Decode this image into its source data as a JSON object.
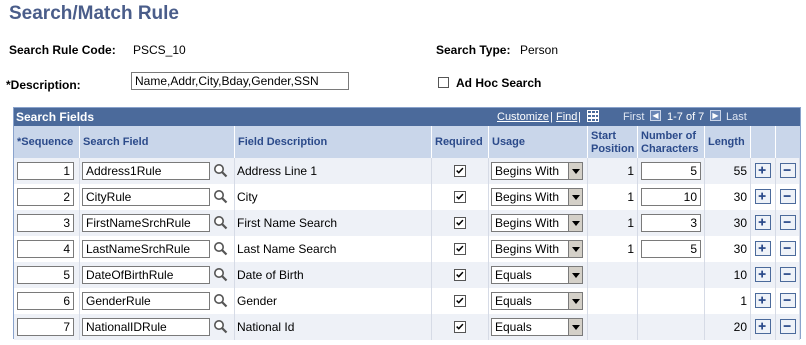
{
  "page": {
    "title": "Search/Match Rule",
    "search_rule_code_label": "Search Rule Code:",
    "search_rule_code_value": "PSCS_10",
    "search_type_label": "Search Type:",
    "search_type_value": "Person",
    "description_label": "*Description:",
    "description_value": "Name,Addr,City,Bday,Gender,SSN",
    "adhoc_label": "Ad Hoc Search",
    "adhoc_checked": false
  },
  "grid": {
    "title": "Search Fields",
    "customize": "Customize",
    "find": "Find",
    "separator": "|",
    "first": "First",
    "range": "1-7 of 7",
    "last": "Last",
    "headers": {
      "sequence": "*Sequence",
      "search_field": "Search Field",
      "field_description": "Field Description",
      "required": "Required",
      "usage": "Usage",
      "start_position_1": "Start",
      "start_position_2": "Position",
      "num_chars_1": "Number of",
      "num_chars_2": "Characters",
      "length": "Length"
    },
    "rows": [
      {
        "sequence": "1",
        "search_field": "Address1Rule",
        "description": "Address Line 1",
        "required": true,
        "usage": "Begins With",
        "start": "1",
        "num_chars": "5",
        "length": "55"
      },
      {
        "sequence": "2",
        "search_field": "CityRule",
        "description": "City",
        "required": true,
        "usage": "Begins With",
        "start": "1",
        "num_chars": "10",
        "length": "30"
      },
      {
        "sequence": "3",
        "search_field": "FirstNameSrchRule",
        "description": "First Name Search",
        "required": true,
        "usage": "Begins With",
        "start": "1",
        "num_chars": "3",
        "length": "30"
      },
      {
        "sequence": "4",
        "search_field": "LastNameSrchRule",
        "description": "Last Name Search",
        "required": true,
        "usage": "Begins With",
        "start": "1",
        "num_chars": "5",
        "length": "30"
      },
      {
        "sequence": "5",
        "search_field": "DateOfBirthRule",
        "description": "Date of Birth",
        "required": true,
        "usage": "Equals",
        "start": "",
        "num_chars": "",
        "length": "10"
      },
      {
        "sequence": "6",
        "search_field": "GenderRule",
        "description": "Gender",
        "required": true,
        "usage": "Equals",
        "start": "",
        "num_chars": "",
        "length": "1"
      },
      {
        "sequence": "7",
        "search_field": "NationalIDRule",
        "description": "National Id",
        "required": true,
        "usage": "Equals",
        "start": "",
        "num_chars": "",
        "length": "20"
      }
    ]
  },
  "colors": {
    "title": "#4a5d8a",
    "grid_bar": "#4b6a9b",
    "header_bg": "#c9d6ea",
    "row_alt": "#eef1f7"
  },
  "icons": {
    "lookup": "magnifier-icon",
    "add": "plus-icon",
    "delete": "minus-icon",
    "view_all": "grid-icon",
    "prev": "arrow-left-icon",
    "next": "arrow-right-icon"
  }
}
